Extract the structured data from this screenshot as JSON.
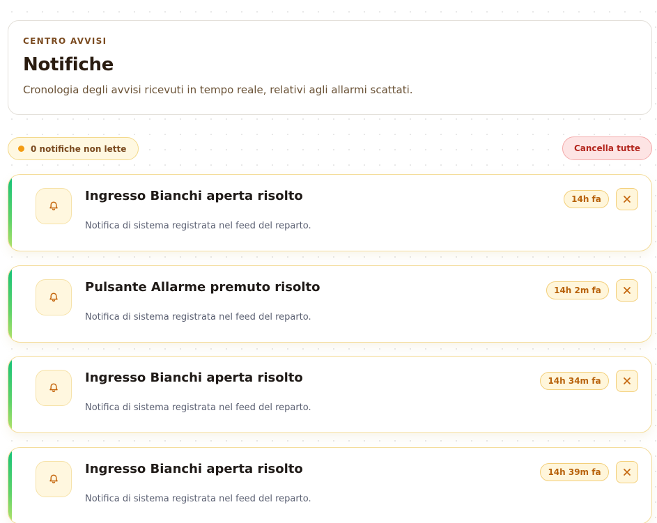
{
  "header": {
    "eyebrow": "CENTRO AVVISI",
    "title": "Notifiche",
    "description": "Cronologia degli avvisi ricevuti in tempo reale, relativi agli allarmi scattati."
  },
  "toolbar": {
    "unread_label": "0 notifiche non lette",
    "clear_all_label": "Cancella tutte"
  },
  "notifications": [
    {
      "title": "Ingresso Bianchi aperta risolto",
      "description": "Notifica di sistema registrata nel feed del reparto.",
      "time": "14h fa"
    },
    {
      "title": "Pulsante Allarme premuto risolto",
      "description": "Notifica di sistema registrata nel feed del reparto.",
      "time": "14h 2m fa"
    },
    {
      "title": "Ingresso Bianchi aperta risolto",
      "description": "Notifica di sistema registrata nel feed del reparto.",
      "time": "14h 34m fa"
    },
    {
      "title": "Ingresso Bianchi aperta risolto",
      "description": "Notifica di sistema registrata nel feed del reparto.",
      "time": "14h 39m fa"
    }
  ],
  "icons": {
    "notification": "bell-icon",
    "dismiss": "close-icon",
    "unread": "dot-icon"
  },
  "colors": {
    "accent_start": "#12c27a",
    "accent_end": "#b7e26a",
    "time_text": "#b8620b",
    "danger": "#b3261e",
    "unread_dot": "#f39c12"
  }
}
